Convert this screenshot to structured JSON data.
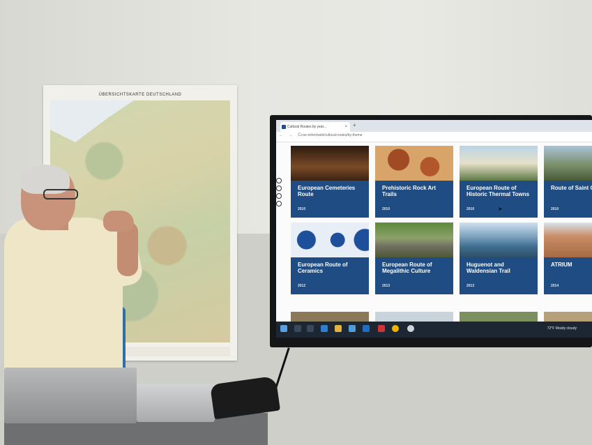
{
  "map": {
    "title": "ÜBERSICHTSKARTE DEUTSCHLAND"
  },
  "browser": {
    "tab_title": "Cultural Routes by year...",
    "tab_close": "×",
    "new_tab": "+",
    "nav_icons": "← → C",
    "url": "coe.int/en/web/cultural-routes/by-theme"
  },
  "cards": [
    {
      "title": "European Cemeteries Route",
      "year": "2010",
      "image_color": "#5a3a22"
    },
    {
      "title": "Prehistoric Rock Art Trails",
      "year": "2010",
      "image_color": "#c8874a"
    },
    {
      "title": "European Route of Historic Thermal Towns",
      "year": "2010",
      "image_color": "#8fb3c9"
    },
    {
      "title": "Route of Saint Olav Ways",
      "year": "2010",
      "image_color": "#6f7f5a"
    },
    {
      "title": "European Route of Ceramics",
      "year": "2012",
      "image_color": "#3d6aa8"
    },
    {
      "title": "European Route of Megalithic Culture",
      "year": "2013",
      "image_color": "#5d7a3e"
    },
    {
      "title": "Huguenot and Waldensian Trail",
      "year": "2013",
      "image_color": "#5f8fb0"
    },
    {
      "title": "ATRIUM",
      "year": "2014",
      "image_color": "#b6784f"
    }
  ],
  "taskbar": {
    "weather": "72°F Mostly cloudy"
  }
}
